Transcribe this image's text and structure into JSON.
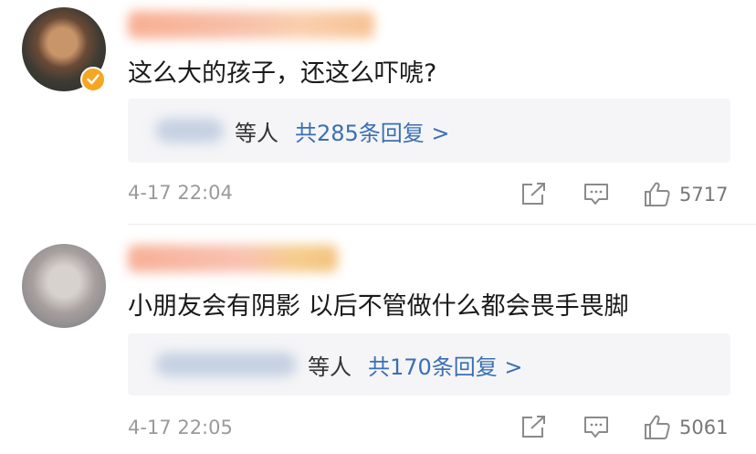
{
  "comments": [
    {
      "text": "这么大的孩子，还这么吓唬?",
      "reply_etc": "等人",
      "reply_link": "共285条回复 >",
      "time": "4-17 22:04",
      "likes": "5717",
      "verified": true
    },
    {
      "text": "小朋友会有阴影 以后不管做什么都会畏手畏脚",
      "reply_etc": "等人",
      "reply_link": "共170条回复 >",
      "time": "4-17 22:05",
      "likes": "5061",
      "verified": false
    }
  ],
  "icons": {
    "share": "share-icon",
    "comment": "comment-icon",
    "like": "thumbs-up-icon",
    "verified": "verified-badge-icon"
  },
  "colors": {
    "link": "#3a6fb3",
    "badge": "#f5a623",
    "reply_bg": "#f5f5f7"
  }
}
